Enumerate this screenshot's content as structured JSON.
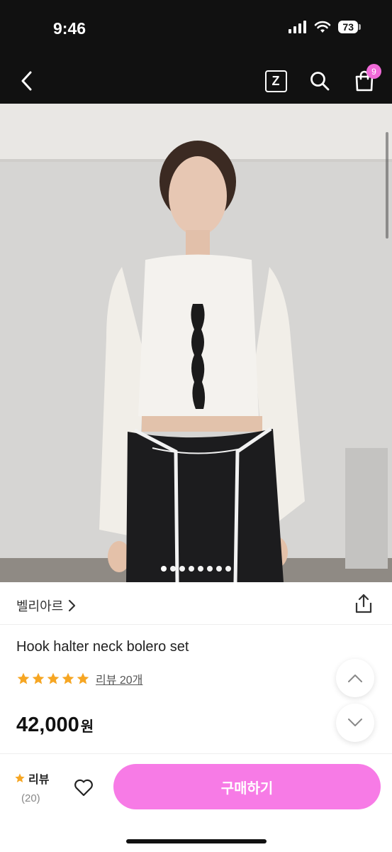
{
  "status_bar": {
    "time": "9:46",
    "battery": "73"
  },
  "nav": {
    "z_label": "Z",
    "cart_count": "9"
  },
  "gallery": {
    "total_images": 8,
    "active_index": 0
  },
  "brand": {
    "name": "벨리아르",
    "chevron": "›"
  },
  "product": {
    "title": "Hook halter neck bolero set",
    "rating_stars": 5,
    "review_link": "리뷰 20개",
    "price": "42,000",
    "price_unit": "원"
  },
  "bottom_bar": {
    "review_label": "리뷰",
    "review_count": "(20)",
    "buy_label": "구매하기"
  },
  "colors": {
    "accent": "#f77be6",
    "star": "#f6a623",
    "badge": "#f06ad8"
  },
  "icons": [
    "back-icon",
    "z-icon",
    "search-icon",
    "cart-icon",
    "share-icon",
    "chevron-up-icon",
    "chevron-down-icon",
    "heart-icon",
    "star-icon"
  ]
}
